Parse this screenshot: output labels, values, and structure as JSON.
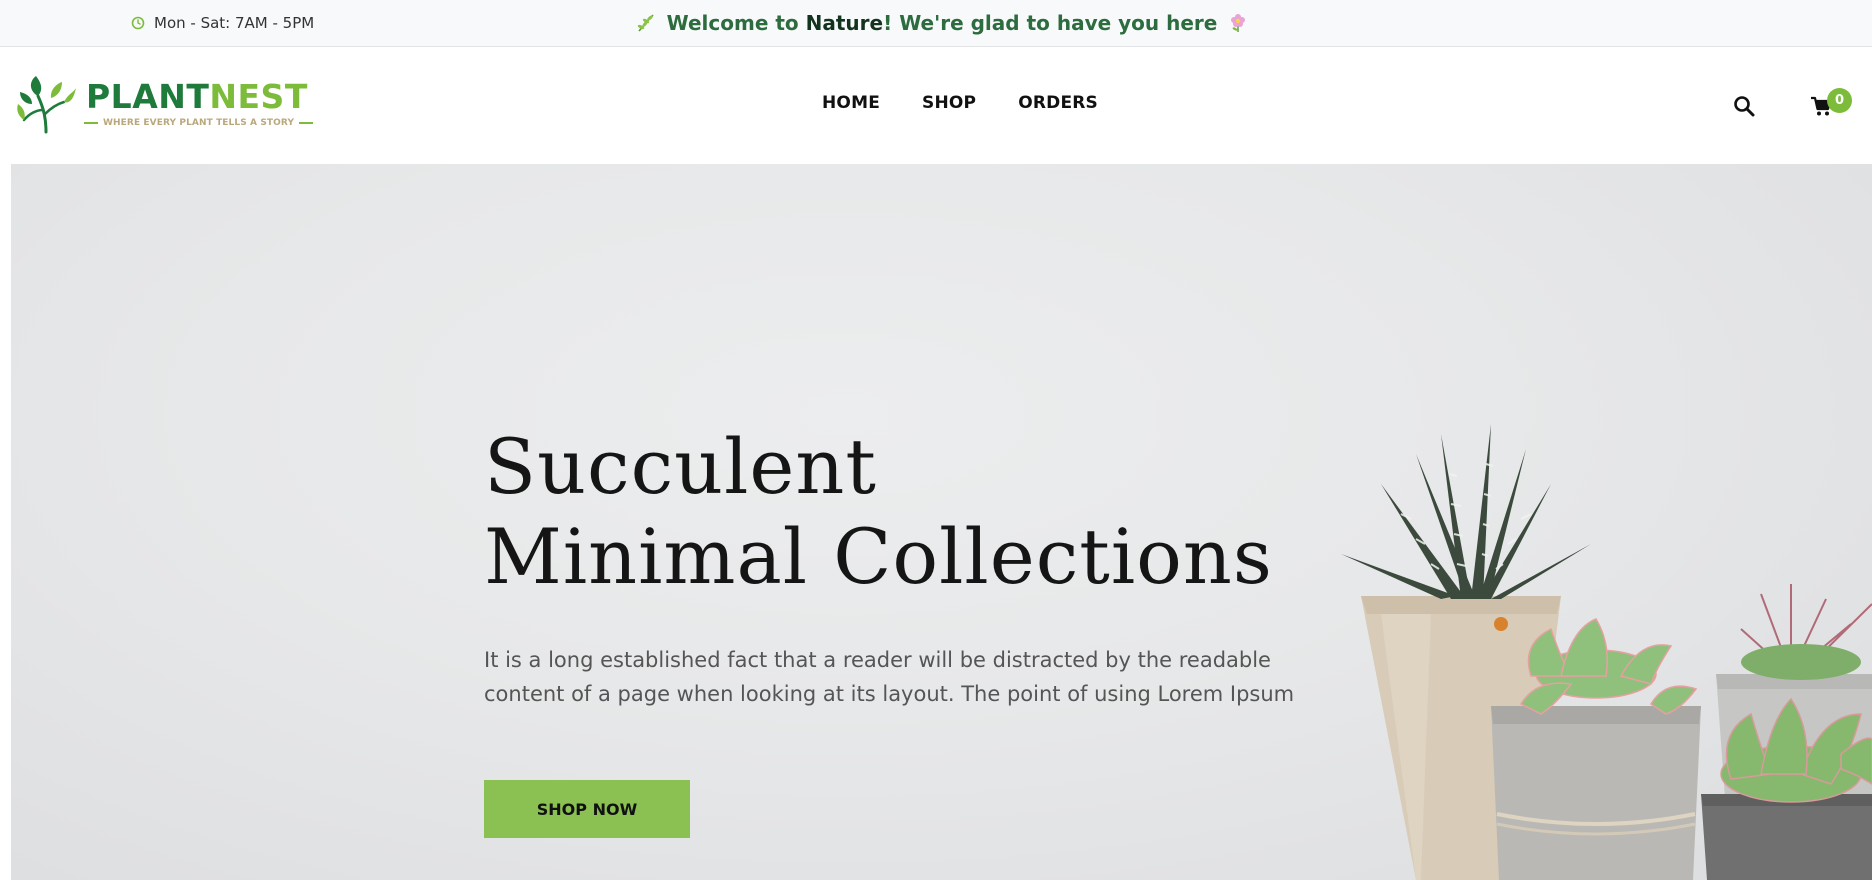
{
  "topbar": {
    "hours": "Mon - Sat: 7AM - 5PM",
    "hours_icon": "clock-icon",
    "welcome_prefix": "Welcome to",
    "welcome_highlight": "Nature",
    "welcome_suffix": "! We're glad to have you here",
    "left_emoji_icon": "herb-icon",
    "right_emoji_icon": "flower-icon"
  },
  "header": {
    "logo_plant": "PLANT",
    "logo_nest": "NEST",
    "logo_tagline": "WHERE EVERY PLANT TELLS A STORY",
    "nav": [
      {
        "label": "HOME"
      },
      {
        "label": "SHOP"
      },
      {
        "label": "ORDERS"
      }
    ],
    "search_icon": "search-icon",
    "cart_icon": "cart-icon",
    "cart_count": "0"
  },
  "hero": {
    "title_line1": "Succulent",
    "title_line2": "Minimal Collections",
    "text_line1": "It is a long established fact that a reader will be distracted by the readable",
    "text_line2": "content of a page when looking at its layout. The point of using Lorem Ipsum",
    "button_label": "SHOP NOW",
    "image": "succulent-pots-image"
  },
  "colors": {
    "brand_green": "#7cbc3a",
    "brand_dark_green": "#1e7b3b",
    "welcome_text": "#2c6c3e",
    "button_bg": "#8bc053",
    "hero_bg": "#e8e9ea"
  }
}
